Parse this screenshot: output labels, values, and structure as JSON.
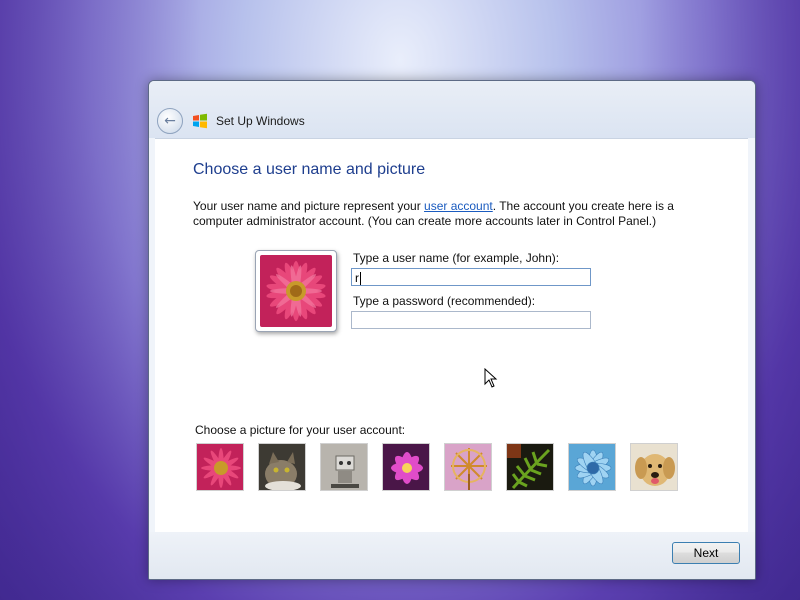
{
  "window": {
    "title": "Set Up Windows"
  },
  "page": {
    "heading": "Choose a user name and picture",
    "description_before_link": "Your user name and picture represent your ",
    "description_link": "user account",
    "description_after_link": ". The account you create here is a computer administrator account. (You can create more accounts later in Control Panel.)"
  },
  "form": {
    "username_label": "Type a user name (for example, John):",
    "username_value": "r",
    "password_label": "Type a password (recommended):",
    "password_value": ""
  },
  "pictures": {
    "label": "Choose a picture for your user account:",
    "items": [
      "flower-daisy",
      "kitten",
      "robot-toy",
      "pink-flower",
      "pinwheel",
      "fern",
      "blue-flower",
      "dog"
    ]
  },
  "footer": {
    "next_label": "Next"
  },
  "colors": {
    "heading": "#1e3e8e",
    "link": "#1a5bbf",
    "button_border": "#3c7fb1"
  }
}
